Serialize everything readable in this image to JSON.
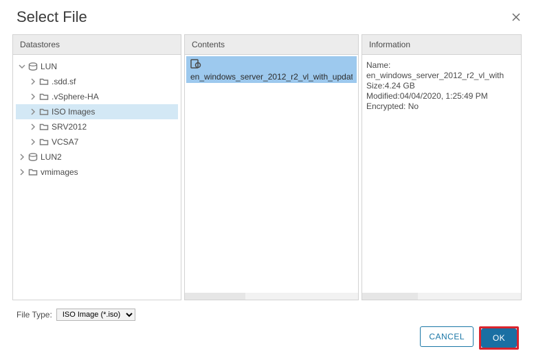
{
  "dialog": {
    "title": "Select File"
  },
  "panels": {
    "datastores_header": "Datastores",
    "contents_header": "Contents",
    "info_header": "Information"
  },
  "tree": {
    "lun_label": "LUN",
    "sdd_label": ".sdd.sf",
    "vsphereha_label": ".vSphere-HA",
    "iso_label": "ISO Images",
    "srv_label": "SRV2012",
    "vcsa_label": "VCSA7",
    "lun2_label": "LUN2",
    "vmimages_label": "vmimages"
  },
  "contents": {
    "file_name": "en_windows_server_2012_r2_vl_with_updat"
  },
  "info": {
    "name_label": "Name:",
    "name_value": "en_windows_server_2012_r2_vl_with",
    "size_label": "Size:",
    "size_value": "4.24 GB",
    "modified_label": "Modified:",
    "modified_value": "04/04/2020, 1:25:49 PM",
    "encrypted_label": "Encrypted:",
    "encrypted_value": " No"
  },
  "file_type": {
    "label": "File Type:",
    "selected": "ISO Image (*.iso)"
  },
  "buttons": {
    "cancel": "CANCEL",
    "ok": "OK"
  }
}
